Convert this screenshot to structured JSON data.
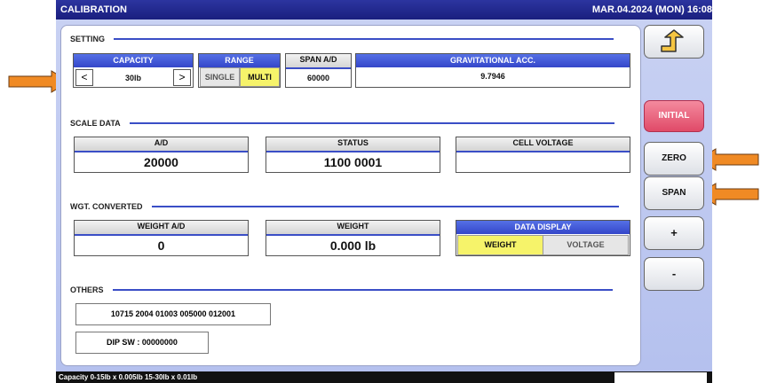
{
  "titlebar": {
    "title": "CALIBRATION",
    "datetime": "MAR.04.2024 (MON) 16:08"
  },
  "setting": {
    "section_label": "SETTING",
    "capacity": {
      "header": "CAPACITY",
      "value": "30lb",
      "prev": "<",
      "next": ">"
    },
    "range": {
      "header": "RANGE",
      "single": "SINGLE",
      "multi": "MULTI",
      "selected": "MULTI"
    },
    "span_ad": {
      "header": "SPAN A/D",
      "value": "60000"
    },
    "grav_acc": {
      "header": "GRAVITATIONAL ACC.",
      "value": "9.7946"
    }
  },
  "scale_data": {
    "section_label": "SCALE DATA",
    "ad": {
      "header": "A/D",
      "value": "20000"
    },
    "status": {
      "header": "STATUS",
      "value": "1100 0001"
    },
    "cell_voltage": {
      "header": "CELL VOLTAGE",
      "value": ""
    }
  },
  "wgt_converted": {
    "section_label": "WGT. CONVERTED",
    "weight_ad": {
      "header": "WEIGHT A/D",
      "value": "0"
    },
    "weight": {
      "header": "WEIGHT",
      "value": "0.000 lb"
    },
    "data_display": {
      "header": "DATA DISPLAY",
      "weight": "WEIGHT",
      "voltage": "VOLTAGE",
      "selected": "WEIGHT"
    }
  },
  "others": {
    "section_label": "OTHERS",
    "code": "10715 2004 01003 005000 012001",
    "dip_sw": "DIP SW : 00000000"
  },
  "side_buttons": {
    "back_icon": "return-arrow-icon",
    "initial": "INITIAL",
    "zero": "ZERO",
    "span": "SPAN",
    "plus": "+",
    "minus": "-"
  },
  "status_bar": {
    "text": "Capacity 0-15lb x 0.005lb  15-30lb x 0.01lb"
  },
  "colors": {
    "accent": "#3446c9",
    "title_bar": "#1a1f7e",
    "highlight": "#f6f36a",
    "initial_button": "#e04a68",
    "annotation_arrow": "#f08a24"
  }
}
